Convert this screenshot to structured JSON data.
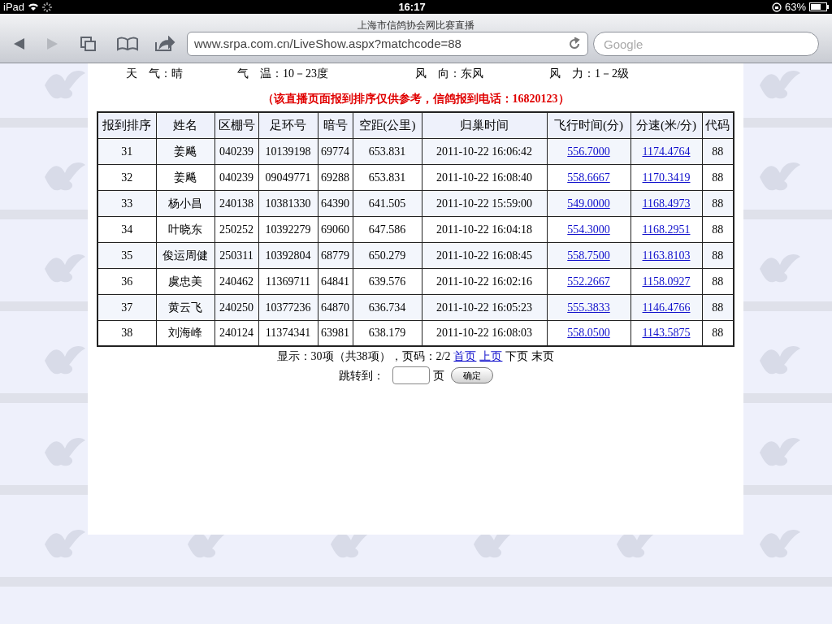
{
  "status_bar": {
    "device": "iPad",
    "time": "16:17",
    "battery": "63%"
  },
  "browser": {
    "page_title": "上海市信鸽协会网比赛直播",
    "url": "www.srpa.com.cn/LiveShow.aspx?matchcode=88",
    "search_placeholder": "Google"
  },
  "weather": [
    {
      "label": "天　气：",
      "value": "晴"
    },
    {
      "label": "气　温：",
      "value": "10－23度"
    },
    {
      "label": "风　向：",
      "value": "东风"
    },
    {
      "label": "风　力：",
      "value": "1－2级"
    }
  ],
  "notice": "（该直播页面报到排序仅供参考，信鸽报到电话：16820123）",
  "table": {
    "columns": [
      "报到排序",
      "姓名",
      "区棚号",
      "足环号",
      "暗号",
      "空距(公里)",
      "归巢时间",
      "飞行时间(分)",
      "分速(米/分)",
      "代码"
    ],
    "rows": [
      [
        "31",
        "姜飚",
        "040239",
        "10139198",
        "69774",
        "653.831",
        "2011-10-22 16:06:42",
        "556.7000",
        "1174.4764",
        "88"
      ],
      [
        "32",
        "姜飚",
        "040239",
        "09049771",
        "69288",
        "653.831",
        "2011-10-22 16:08:40",
        "558.6667",
        "1170.3419",
        "88"
      ],
      [
        "33",
        "杨小昌",
        "240138",
        "10381330",
        "64390",
        "641.505",
        "2011-10-22 15:59:00",
        "549.0000",
        "1168.4973",
        "88"
      ],
      [
        "34",
        "叶晓东",
        "250252",
        "10392279",
        "69060",
        "647.586",
        "2011-10-22 16:04:18",
        "554.3000",
        "1168.2951",
        "88"
      ],
      [
        "35",
        "俊运周健",
        "250311",
        "10392804",
        "68779",
        "650.279",
        "2011-10-22 16:08:45",
        "558.7500",
        "1163.8103",
        "88"
      ],
      [
        "36",
        "虞忠美",
        "240462",
        "11369711",
        "64841",
        "639.576",
        "2011-10-22 16:02:16",
        "552.2667",
        "1158.0927",
        "88"
      ],
      [
        "37",
        "黄云飞",
        "240250",
        "10377236",
        "64870",
        "636.734",
        "2011-10-22 16:05:23",
        "555.3833",
        "1146.4766",
        "88"
      ],
      [
        "38",
        "刘海峰",
        "240124",
        "11374341",
        "63981",
        "638.179",
        "2011-10-22 16:08:03",
        "558.0500",
        "1143.5875",
        "88"
      ]
    ]
  },
  "pagination": {
    "summary": "显示：30项（共38项），页码：2/2",
    "links": [
      {
        "label": "首页",
        "disabled": false
      },
      {
        "label": "上页",
        "disabled": false
      },
      {
        "label": "下页",
        "disabled": true
      },
      {
        "label": "末页",
        "disabled": true
      }
    ]
  },
  "jump": {
    "label": "跳转到：",
    "suffix": "页",
    "button": "确定"
  }
}
